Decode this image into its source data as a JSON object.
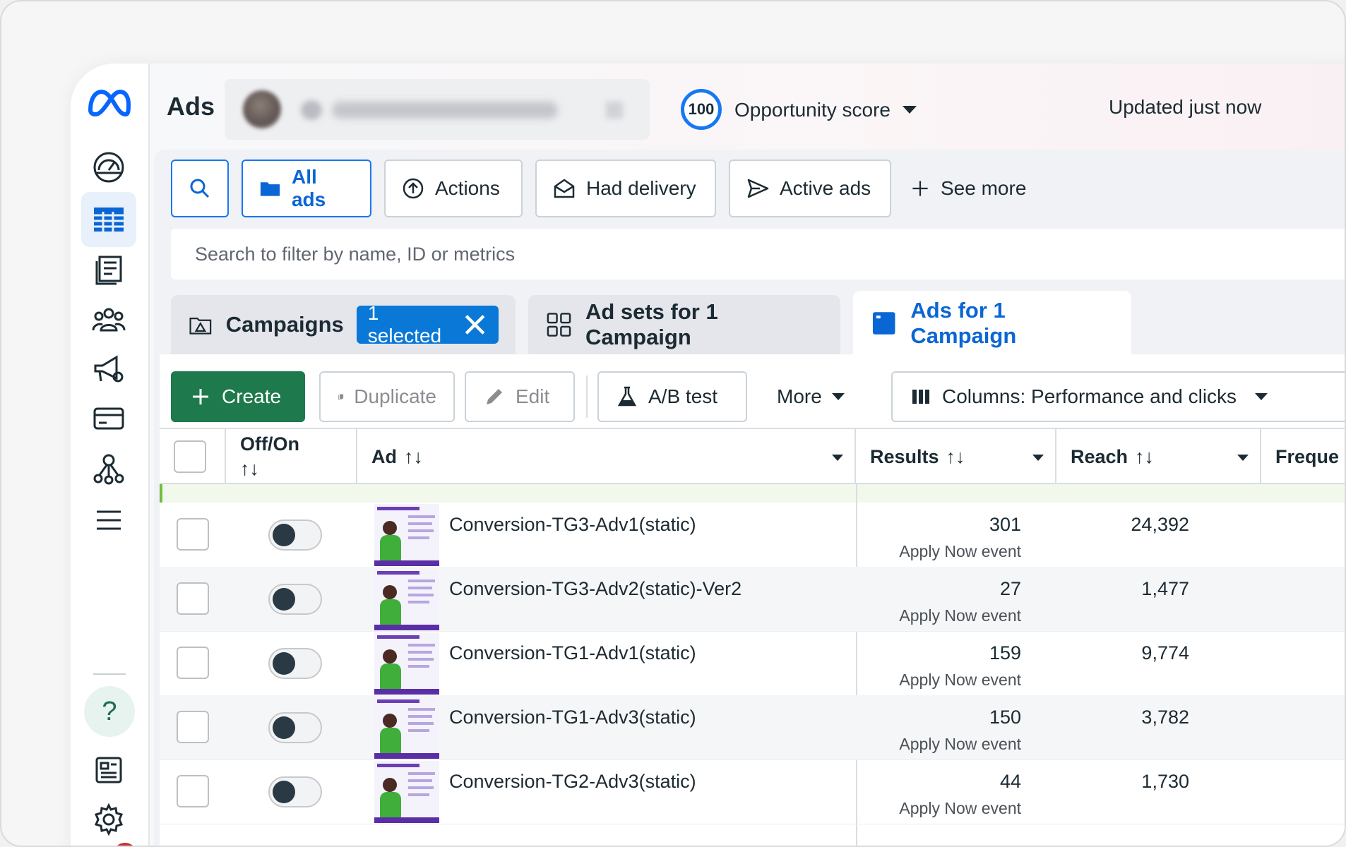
{
  "header": {
    "title": "Ads",
    "score_value": "100",
    "score_label": "Opportunity score",
    "updated": "Updated just now"
  },
  "filters": {
    "all_ads": "All ads",
    "actions": "Actions",
    "had_delivery": "Had delivery",
    "active_ads": "Active ads",
    "see_more": "See more"
  },
  "search": {
    "placeholder": "Search to filter by name, ID or metrics"
  },
  "tabs": {
    "campaigns": "Campaigns",
    "selected": "1 selected",
    "adsets": "Ad sets for 1 Campaign",
    "ads": "Ads for 1 Campaign"
  },
  "toolbar": {
    "create": "Create",
    "duplicate": "Duplicate",
    "edit": "Edit",
    "ab_test": "A/B test",
    "more": "More",
    "columns": "Columns: Performance and clicks"
  },
  "table": {
    "headers": {
      "offon": "Off/On",
      "sort_glyph": "↑↓",
      "ad": "Ad",
      "results": "Results",
      "reach": "Reach",
      "frequency": "Freque"
    },
    "rows": [
      {
        "name": "Conversion-TG3-Adv1(static)",
        "results": "301",
        "result_type": "Apply Now event",
        "reach": "24,392"
      },
      {
        "name": "Conversion-TG3-Adv2(static)-Ver2",
        "results": "27",
        "result_type": "Apply Now event",
        "reach": "1,477"
      },
      {
        "name": "Conversion-TG1-Adv1(static)",
        "results": "159",
        "result_type": "Apply Now event",
        "reach": "9,774"
      },
      {
        "name": "Conversion-TG1-Adv3(static)",
        "results": "150",
        "result_type": "Apply Now event",
        "reach": "3,782"
      },
      {
        "name": "Conversion-TG2-Adv3(static)",
        "results": "44",
        "result_type": "Apply Now event",
        "reach": "1,730"
      }
    ]
  },
  "colors": {
    "brand_blue": "#1877f2",
    "create_green": "#1e7a4c",
    "selected_pill": "#0a78d7"
  }
}
